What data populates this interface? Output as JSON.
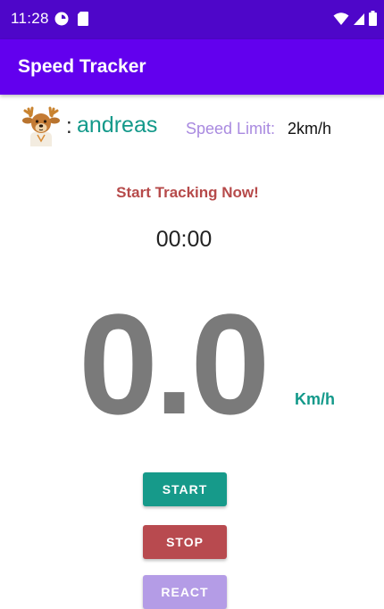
{
  "status_bar": {
    "time": "11:28",
    "icons": [
      "data-saver-icon",
      "sim-card-icon",
      "wifi-icon",
      "signal-icon",
      "battery-icon"
    ]
  },
  "app_bar": {
    "title": "Speed Tracker"
  },
  "user": {
    "colon": ":",
    "name": "andreas",
    "avatar_icon": "deer-avatar-icon"
  },
  "speed_limit": {
    "label": "Speed Limit:",
    "value": "2km/h"
  },
  "tracking_message": "Start Tracking Now!",
  "timer": "00:00",
  "speed": {
    "value": "0.0",
    "unit": "Km/h"
  },
  "buttons": {
    "start": "START",
    "stop": "STOP",
    "react": "REACT"
  },
  "colors": {
    "status_bar": "#4e06c9",
    "app_bar": "#6200ee",
    "accent_teal": "#13998a",
    "message_red": "#b64a4a",
    "speed_gray": "#7a7a7a",
    "limit_label": "#a98ae0",
    "start_button": "#169a8a",
    "stop_button": "#b84a4f",
    "react_button": "#b49ce6"
  }
}
